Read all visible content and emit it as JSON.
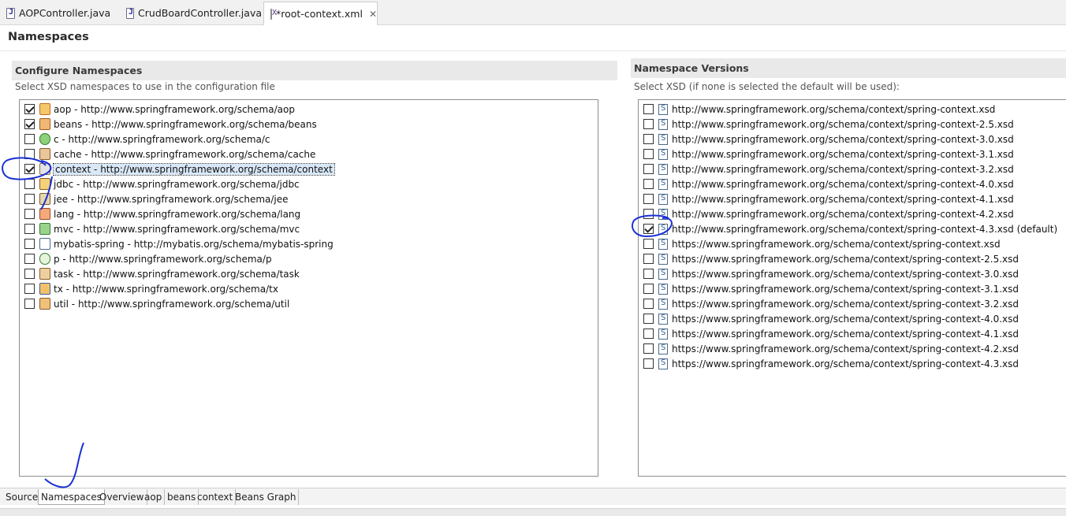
{
  "editor_tabs": [
    {
      "label": "AOPController.java",
      "icon": "java-file-icon"
    },
    {
      "label": "CrudBoardController.java",
      "icon": "java-file-icon"
    },
    {
      "label": "*root-context.xml",
      "icon": "xml-file-icon",
      "close": "✕"
    }
  ],
  "page_title": "Namespaces",
  "left": {
    "header": "Configure Namespaces",
    "description": "Select XSD namespaces to use in the configuration file",
    "items": [
      {
        "label": "aop - http://www.springframework.org/schema/aop",
        "checked": true,
        "icon": "aop-icon"
      },
      {
        "label": "beans - http://www.springframework.org/schema/beans",
        "checked": true,
        "icon": "beans-icon"
      },
      {
        "label": "c - http://www.springframework.org/schema/c",
        "checked": false,
        "icon": "c-namespace-icon"
      },
      {
        "label": "cache - http://www.springframework.org/schema/cache",
        "checked": false,
        "icon": "cache-icon"
      },
      {
        "label": "context - http://www.springframework.org/schema/context",
        "checked": true,
        "icon": "context-icon",
        "selected": true
      },
      {
        "label": "jdbc - http://www.springframework.org/schema/jdbc",
        "checked": false,
        "icon": "jdbc-icon"
      },
      {
        "label": "jee - http://www.springframework.org/schema/jee",
        "checked": false,
        "icon": "jee-icon"
      },
      {
        "label": "lang - http://www.springframework.org/schema/lang",
        "checked": false,
        "icon": "lang-icon"
      },
      {
        "label": "mvc - http://www.springframework.org/schema/mvc",
        "checked": false,
        "icon": "mvc-icon"
      },
      {
        "label": "mybatis-spring - http://mybatis.org/schema/mybatis-spring",
        "checked": false,
        "icon": "mybatis-icon"
      },
      {
        "label": "p - http://www.springframework.org/schema/p",
        "checked": false,
        "icon": "p-namespace-icon"
      },
      {
        "label": "task - http://www.springframework.org/schema/task",
        "checked": false,
        "icon": "task-icon"
      },
      {
        "label": "tx - http://www.springframework.org/schema/tx",
        "checked": false,
        "icon": "tx-icon"
      },
      {
        "label": "util - http://www.springframework.org/schema/util",
        "checked": false,
        "icon": "util-icon"
      }
    ]
  },
  "right": {
    "header": "Namespace Versions",
    "description": "Select XSD (if none is selected the default will be used):",
    "items": [
      {
        "label": "http://www.springframework.org/schema/context/spring-context.xsd",
        "checked": false
      },
      {
        "label": "http://www.springframework.org/schema/context/spring-context-2.5.xsd",
        "checked": false
      },
      {
        "label": "http://www.springframework.org/schema/context/spring-context-3.0.xsd",
        "checked": false
      },
      {
        "label": "http://www.springframework.org/schema/context/spring-context-3.1.xsd",
        "checked": false
      },
      {
        "label": "http://www.springframework.org/schema/context/spring-context-3.2.xsd",
        "checked": false
      },
      {
        "label": "http://www.springframework.org/schema/context/spring-context-4.0.xsd",
        "checked": false
      },
      {
        "label": "http://www.springframework.org/schema/context/spring-context-4.1.xsd",
        "checked": false
      },
      {
        "label": "http://www.springframework.org/schema/context/spring-context-4.2.xsd",
        "checked": false
      },
      {
        "label": "http://www.springframework.org/schema/context/spring-context-4.3.xsd (default)",
        "checked": true
      },
      {
        "label": "https://www.springframework.org/schema/context/spring-context.xsd",
        "checked": false
      },
      {
        "label": "https://www.springframework.org/schema/context/spring-context-2.5.xsd",
        "checked": false
      },
      {
        "label": "https://www.springframework.org/schema/context/spring-context-3.0.xsd",
        "checked": false
      },
      {
        "label": "https://www.springframework.org/schema/context/spring-context-3.1.xsd",
        "checked": false
      },
      {
        "label": "https://www.springframework.org/schema/context/spring-context-3.2.xsd",
        "checked": false
      },
      {
        "label": "https://www.springframework.org/schema/context/spring-context-4.0.xsd",
        "checked": false
      },
      {
        "label": "https://www.springframework.org/schema/context/spring-context-4.1.xsd",
        "checked": false
      },
      {
        "label": "https://www.springframework.org/schema/context/spring-context-4.2.xsd",
        "checked": false
      },
      {
        "label": "https://www.springframework.org/schema/context/spring-context-4.3.xsd",
        "checked": false
      }
    ]
  },
  "bottom_tabs": [
    {
      "label": "Source",
      "active": false
    },
    {
      "label": "Namespaces",
      "active": true
    },
    {
      "label": "Overview",
      "active": false
    },
    {
      "label": "aop",
      "active": false
    },
    {
      "label": "beans",
      "active": false
    },
    {
      "label": "context",
      "active": false
    },
    {
      "label": "Beans Graph",
      "active": false
    }
  ],
  "annotation_color": "#1a2fd6",
  "colors": {
    "selection": "#d9e8f7",
    "section_header": "#e9e9e9"
  }
}
